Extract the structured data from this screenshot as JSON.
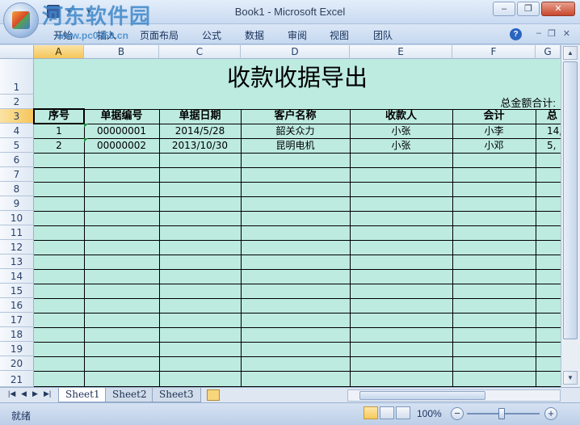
{
  "window": {
    "title": "Book1 - Microsoft Excel",
    "controls": {
      "minimize": "–",
      "restore": "❐",
      "close": "✕"
    }
  },
  "watermark": {
    "site": "河东软件园",
    "url": "www.pc0359.cn"
  },
  "ribbon": {
    "tabs": [
      "开始",
      "插入",
      "页面布局",
      "公式",
      "数据",
      "审阅",
      "视图",
      "团队"
    ],
    "help": "?",
    "ribbon_controls": {
      "minimize": "–",
      "restore": "❐",
      "close": "✕"
    }
  },
  "columns": [
    "A",
    "B",
    "C",
    "D",
    "E",
    "F",
    "G"
  ],
  "rows": [
    "1",
    "2",
    "3",
    "4",
    "5",
    "6",
    "7",
    "8",
    "9",
    "10",
    "11",
    "12",
    "13",
    "14",
    "15",
    "16",
    "17",
    "18",
    "19",
    "20",
    "21"
  ],
  "selected": {
    "column": "A",
    "row": "3"
  },
  "sheet": {
    "title": "收款收据导出",
    "total_label": "总金额合计:",
    "headers": [
      "序号",
      "单据编号",
      "单据日期",
      "客户名称",
      "收款人",
      "会计",
      "总"
    ],
    "records": [
      [
        "1",
        "00000001",
        "2014/5/28",
        "韶关众力",
        "小张",
        "小李",
        "14,"
      ],
      [
        "2",
        "00000002",
        "2013/10/30",
        "昆明电机",
        "小张",
        "小邓",
        "5,"
      ]
    ]
  },
  "sheet_tabs": [
    "Sheet1",
    "Sheet2",
    "Sheet3"
  ],
  "active_sheet": "Sheet1",
  "status": {
    "ready": "就绪",
    "zoom": "100%",
    "zoom_level_percent": 100
  },
  "colors": {
    "sheet_fill": "#bdebdf",
    "accent": "#3f88c9"
  }
}
